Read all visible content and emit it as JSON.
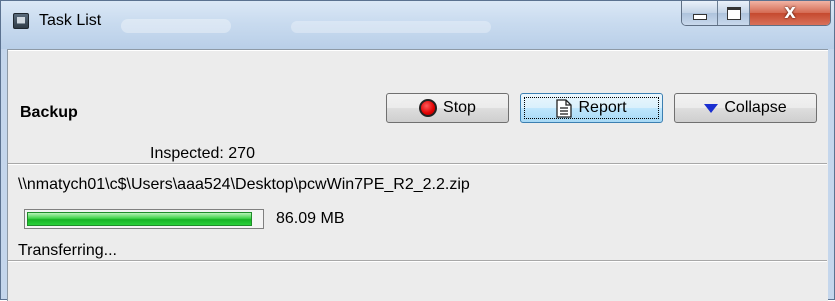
{
  "window": {
    "title": "Task List",
    "caption": {
      "close_glyph": "X"
    }
  },
  "task": {
    "name": "Backup",
    "buttons": {
      "stop_label": "Stop",
      "report_label": "Report",
      "collapse_label": "Collapse"
    },
    "inspected_label": "Inspected:",
    "inspected_count": "270",
    "file_path": "\\\\nmatych01\\c$\\Users\\aaa524\\Desktop\\pcwWin7PE_R2_2.2.zip",
    "progress": {
      "fraction": 0.96
    },
    "transferred_size": "86.09 MB",
    "status": "Transferring..."
  },
  "colors": {
    "progress_fill": "#17b325",
    "stop_icon": "#e00000",
    "collapse_icon": "#1a2fd0",
    "close_button": "#c54a2f"
  },
  "icons": {
    "app": "task-list-icon",
    "stop": "stop-icon",
    "report": "document-icon",
    "collapse": "triangle-down-icon"
  }
}
